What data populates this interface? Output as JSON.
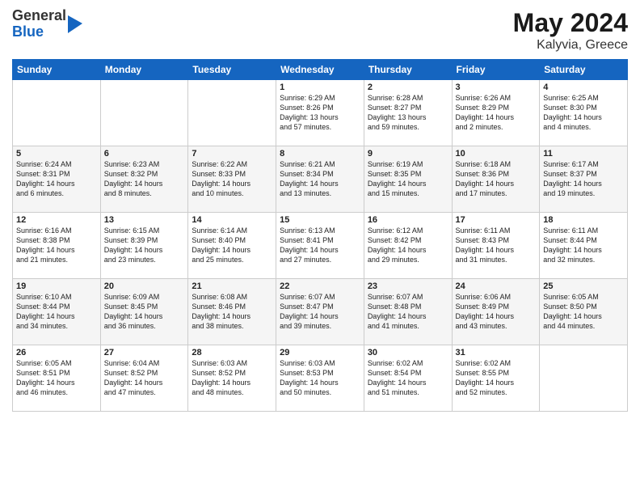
{
  "header": {
    "logo_line1": "General",
    "logo_line2": "Blue",
    "month": "May 2024",
    "location": "Kalyvia, Greece"
  },
  "weekdays": [
    "Sunday",
    "Monday",
    "Tuesday",
    "Wednesday",
    "Thursday",
    "Friday",
    "Saturday"
  ],
  "weeks": [
    [
      {
        "day": "",
        "info": ""
      },
      {
        "day": "",
        "info": ""
      },
      {
        "day": "",
        "info": ""
      },
      {
        "day": "1",
        "info": "Sunrise: 6:29 AM\nSunset: 8:26 PM\nDaylight: 13 hours\nand 57 minutes."
      },
      {
        "day": "2",
        "info": "Sunrise: 6:28 AM\nSunset: 8:27 PM\nDaylight: 13 hours\nand 59 minutes."
      },
      {
        "day": "3",
        "info": "Sunrise: 6:26 AM\nSunset: 8:29 PM\nDaylight: 14 hours\nand 2 minutes."
      },
      {
        "day": "4",
        "info": "Sunrise: 6:25 AM\nSunset: 8:30 PM\nDaylight: 14 hours\nand 4 minutes."
      }
    ],
    [
      {
        "day": "5",
        "info": "Sunrise: 6:24 AM\nSunset: 8:31 PM\nDaylight: 14 hours\nand 6 minutes."
      },
      {
        "day": "6",
        "info": "Sunrise: 6:23 AM\nSunset: 8:32 PM\nDaylight: 14 hours\nand 8 minutes."
      },
      {
        "day": "7",
        "info": "Sunrise: 6:22 AM\nSunset: 8:33 PM\nDaylight: 14 hours\nand 10 minutes."
      },
      {
        "day": "8",
        "info": "Sunrise: 6:21 AM\nSunset: 8:34 PM\nDaylight: 14 hours\nand 13 minutes."
      },
      {
        "day": "9",
        "info": "Sunrise: 6:19 AM\nSunset: 8:35 PM\nDaylight: 14 hours\nand 15 minutes."
      },
      {
        "day": "10",
        "info": "Sunrise: 6:18 AM\nSunset: 8:36 PM\nDaylight: 14 hours\nand 17 minutes."
      },
      {
        "day": "11",
        "info": "Sunrise: 6:17 AM\nSunset: 8:37 PM\nDaylight: 14 hours\nand 19 minutes."
      }
    ],
    [
      {
        "day": "12",
        "info": "Sunrise: 6:16 AM\nSunset: 8:38 PM\nDaylight: 14 hours\nand 21 minutes."
      },
      {
        "day": "13",
        "info": "Sunrise: 6:15 AM\nSunset: 8:39 PM\nDaylight: 14 hours\nand 23 minutes."
      },
      {
        "day": "14",
        "info": "Sunrise: 6:14 AM\nSunset: 8:40 PM\nDaylight: 14 hours\nand 25 minutes."
      },
      {
        "day": "15",
        "info": "Sunrise: 6:13 AM\nSunset: 8:41 PM\nDaylight: 14 hours\nand 27 minutes."
      },
      {
        "day": "16",
        "info": "Sunrise: 6:12 AM\nSunset: 8:42 PM\nDaylight: 14 hours\nand 29 minutes."
      },
      {
        "day": "17",
        "info": "Sunrise: 6:11 AM\nSunset: 8:43 PM\nDaylight: 14 hours\nand 31 minutes."
      },
      {
        "day": "18",
        "info": "Sunrise: 6:11 AM\nSunset: 8:44 PM\nDaylight: 14 hours\nand 32 minutes."
      }
    ],
    [
      {
        "day": "19",
        "info": "Sunrise: 6:10 AM\nSunset: 8:44 PM\nDaylight: 14 hours\nand 34 minutes."
      },
      {
        "day": "20",
        "info": "Sunrise: 6:09 AM\nSunset: 8:45 PM\nDaylight: 14 hours\nand 36 minutes."
      },
      {
        "day": "21",
        "info": "Sunrise: 6:08 AM\nSunset: 8:46 PM\nDaylight: 14 hours\nand 38 minutes."
      },
      {
        "day": "22",
        "info": "Sunrise: 6:07 AM\nSunset: 8:47 PM\nDaylight: 14 hours\nand 39 minutes."
      },
      {
        "day": "23",
        "info": "Sunrise: 6:07 AM\nSunset: 8:48 PM\nDaylight: 14 hours\nand 41 minutes."
      },
      {
        "day": "24",
        "info": "Sunrise: 6:06 AM\nSunset: 8:49 PM\nDaylight: 14 hours\nand 43 minutes."
      },
      {
        "day": "25",
        "info": "Sunrise: 6:05 AM\nSunset: 8:50 PM\nDaylight: 14 hours\nand 44 minutes."
      }
    ],
    [
      {
        "day": "26",
        "info": "Sunrise: 6:05 AM\nSunset: 8:51 PM\nDaylight: 14 hours\nand 46 minutes."
      },
      {
        "day": "27",
        "info": "Sunrise: 6:04 AM\nSunset: 8:52 PM\nDaylight: 14 hours\nand 47 minutes."
      },
      {
        "day": "28",
        "info": "Sunrise: 6:03 AM\nSunset: 8:52 PM\nDaylight: 14 hours\nand 48 minutes."
      },
      {
        "day": "29",
        "info": "Sunrise: 6:03 AM\nSunset: 8:53 PM\nDaylight: 14 hours\nand 50 minutes."
      },
      {
        "day": "30",
        "info": "Sunrise: 6:02 AM\nSunset: 8:54 PM\nDaylight: 14 hours\nand 51 minutes."
      },
      {
        "day": "31",
        "info": "Sunrise: 6:02 AM\nSunset: 8:55 PM\nDaylight: 14 hours\nand 52 minutes."
      },
      {
        "day": "",
        "info": ""
      }
    ]
  ]
}
